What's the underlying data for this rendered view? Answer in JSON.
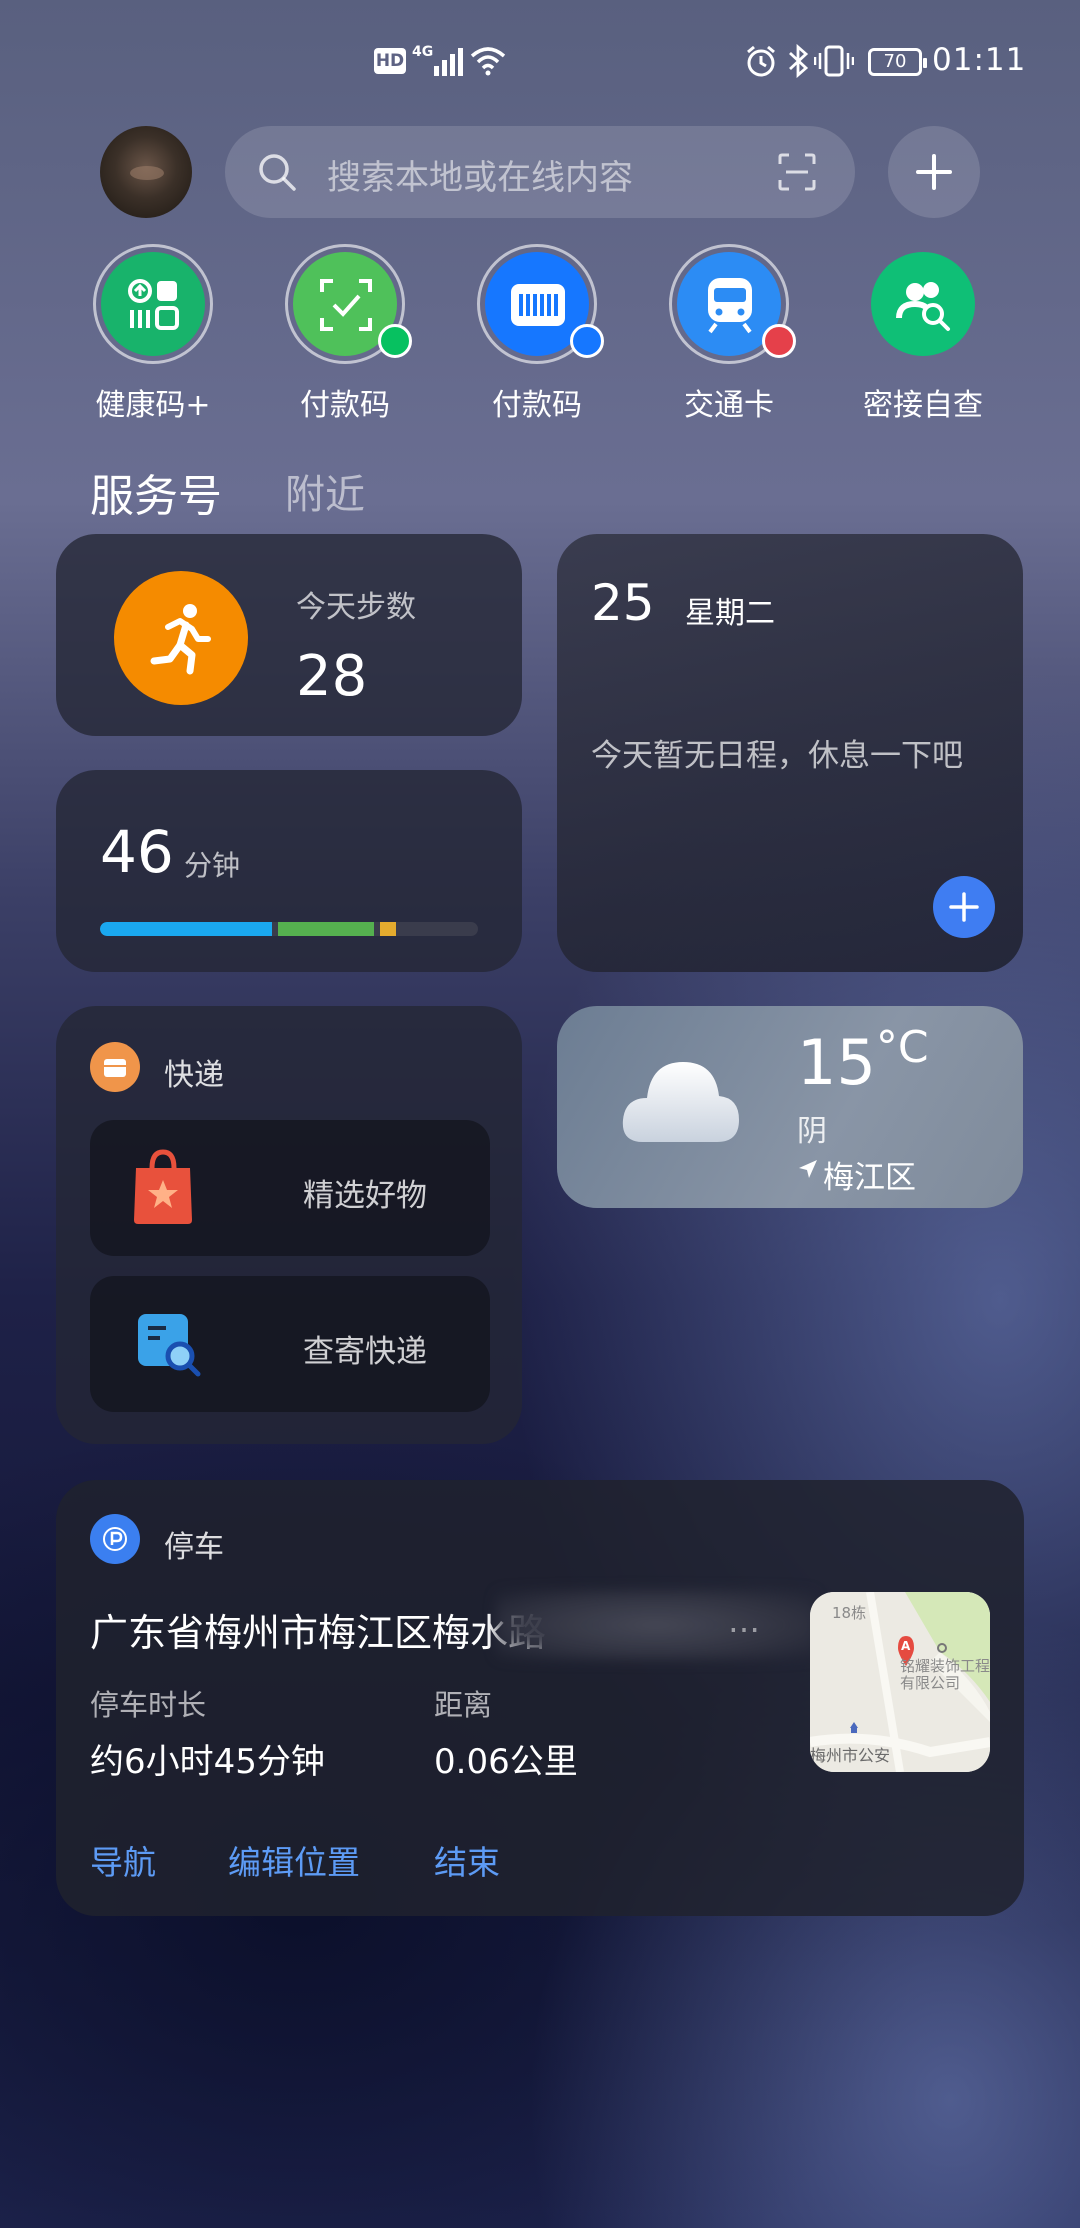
{
  "status_bar": {
    "hd": "HD",
    "network": "4G",
    "battery": "70",
    "time": "01:11"
  },
  "search": {
    "placeholder": "搜索本地或在线内容"
  },
  "shortcuts": [
    {
      "label": "健康码+",
      "color": "#18b36b"
    },
    {
      "label": "付款码",
      "color": "#4fc15a"
    },
    {
      "label": "付款码",
      "color": "#1677ff"
    },
    {
      "label": "交通卡",
      "color": "#2c8cf4"
    },
    {
      "label": "密接自查",
      "color": "#0fbf76"
    }
  ],
  "tabs": {
    "active": "服务号",
    "other": "附近"
  },
  "steps": {
    "label": "今天步数",
    "value": "28"
  },
  "screen_time": {
    "value": "46",
    "unit": "分钟",
    "segments": [
      {
        "color": "#1aa8f0",
        "fraction": 0.47
      },
      {
        "color": "#55b04f",
        "fraction": 0.27
      },
      {
        "color": "#e4ab2e",
        "fraction": 0.06
      }
    ]
  },
  "calendar": {
    "day": "25",
    "weekday": "星期二",
    "empty_text": "今天暂无日程，休息一下吧"
  },
  "express": {
    "title": "快递",
    "items": [
      "精选好物",
      "查寄快递"
    ]
  },
  "weather": {
    "temp": "15",
    "unit": "°C",
    "desc": "阴",
    "location": "梅江区"
  },
  "parking": {
    "title": "停车",
    "address": "广东省梅州市梅江区梅水路",
    "ellipsis": "…",
    "duration_label": "停车时长",
    "duration_value": "约6小时45分钟",
    "distance_label": "距离",
    "distance_value": "0.06公里",
    "actions": [
      "导航",
      "编辑位置",
      "结束"
    ],
    "map": {
      "building": "18栋",
      "marker": "A",
      "poi1": "铭耀装饰工程有限公司",
      "poi2": "梅州市公安"
    }
  }
}
